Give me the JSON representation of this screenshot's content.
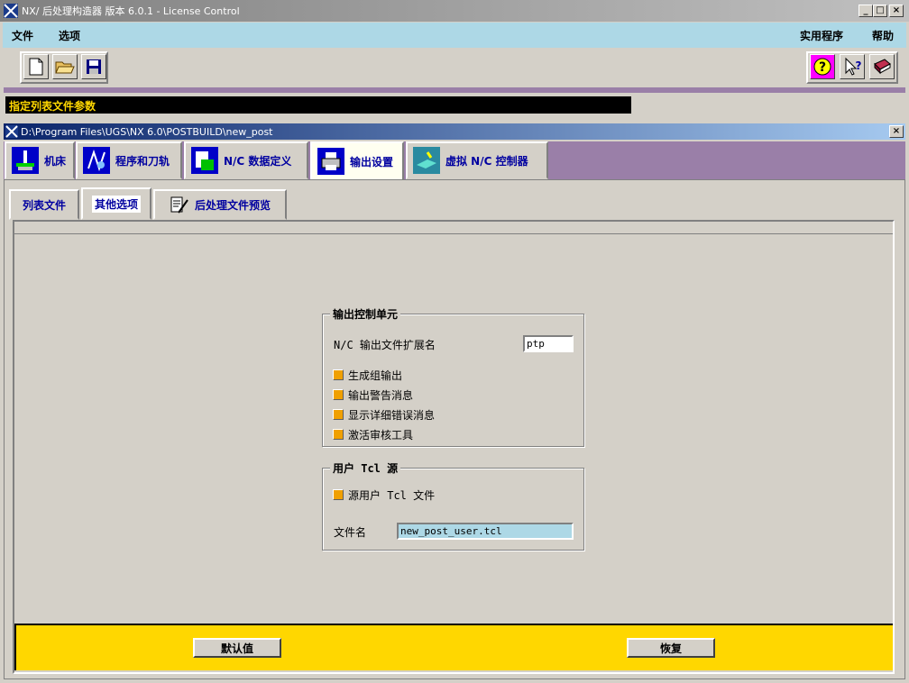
{
  "app": {
    "title": "NX/ 后处理构造器 版本 6.0.1 - License Control",
    "window_buttons": {
      "minimize": "_",
      "maximize": "□",
      "close": "×"
    }
  },
  "menu": {
    "file": "文件",
    "options": "选项",
    "utilities": "实用程序",
    "help": "帮助"
  },
  "status": {
    "message": "指定列表文件参数"
  },
  "subwindow": {
    "title": "D:\\Program Files\\UGS\\NX 6.0\\POSTBUILD\\new_post",
    "close": "×"
  },
  "tabs": [
    {
      "label": "机床",
      "icon": "machine-tool-icon"
    },
    {
      "label": "程序和刀轨",
      "icon": "program-toolpath-icon"
    },
    {
      "label": "N/C 数据定义",
      "icon": "nc-data-icon"
    },
    {
      "label": "输出设置",
      "icon": "printer-icon"
    },
    {
      "label": "虚拟 N/C 控制器",
      "icon": "virtual-controller-icon"
    }
  ],
  "subtabs": [
    {
      "label": "列表文件"
    },
    {
      "label": "其他选项"
    },
    {
      "label": "后处理文件预览",
      "icon": "document-pen-icon"
    }
  ],
  "output_control": {
    "title": "输出控制单元",
    "ext_label": "N/C 输出文件扩展名",
    "ext_value": "ptp",
    "options": [
      "生成组输出",
      "输出警告消息",
      "显示详细错误消息",
      "激活审核工具"
    ]
  },
  "user_tcl": {
    "title": "用户 Tcl 源",
    "source_label": "源用户 Tcl 文件",
    "filename_label": "文件名",
    "filename_value": "new_post_user.tcl"
  },
  "buttons": {
    "default": "默认值",
    "restore": "恢复"
  },
  "colors": {
    "menubar": "#add8e6",
    "tabstrip": "#9a7fa8",
    "status_bg": "#000000",
    "status_text": "#ffd700",
    "footer": "#ffd700",
    "checkbox": "#f0a000",
    "active_subtab": "#0000a0"
  }
}
